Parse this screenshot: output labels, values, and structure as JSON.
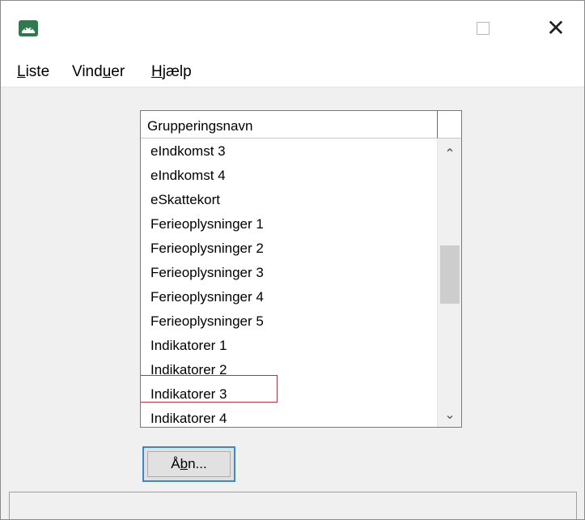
{
  "titlebar": {
    "app_icon": "app-logo-icon",
    "maximize_icon": "maximize-icon",
    "close_icon": "close-icon",
    "close_glyph": "✕"
  },
  "menu": {
    "items": [
      {
        "label": "Liste",
        "mnemonic_index": 0
      },
      {
        "label": "Vinduer",
        "mnemonic_index": 4
      },
      {
        "label": "Hjælp",
        "mnemonic_index": 0
      }
    ]
  },
  "list": {
    "column_header": "Grupperingsnavn",
    "rows": [
      "eIndkomst 3",
      "eIndkomst 4",
      "eSkattekort",
      "Ferieoplysninger 1",
      "Ferieoplysninger 2",
      "Ferieoplysninger 3",
      "Ferieoplysninger 4",
      "Ferieoplysninger 5",
      "Indikatorer 1",
      "Indikatorer 2",
      "Indikatorer 3",
      "Indikatorer 4"
    ],
    "highlighted_row": "Indikatorer 3",
    "scroll_up_glyph": "⌃",
    "scroll_down_glyph": "⌄"
  },
  "open_button": {
    "label": "Åbn...",
    "mnemonic_index": 1
  },
  "colors": {
    "highlight_border": "#c0303a",
    "focus_border": "#3a87d6",
    "app_icon": "#2f7a4a"
  }
}
